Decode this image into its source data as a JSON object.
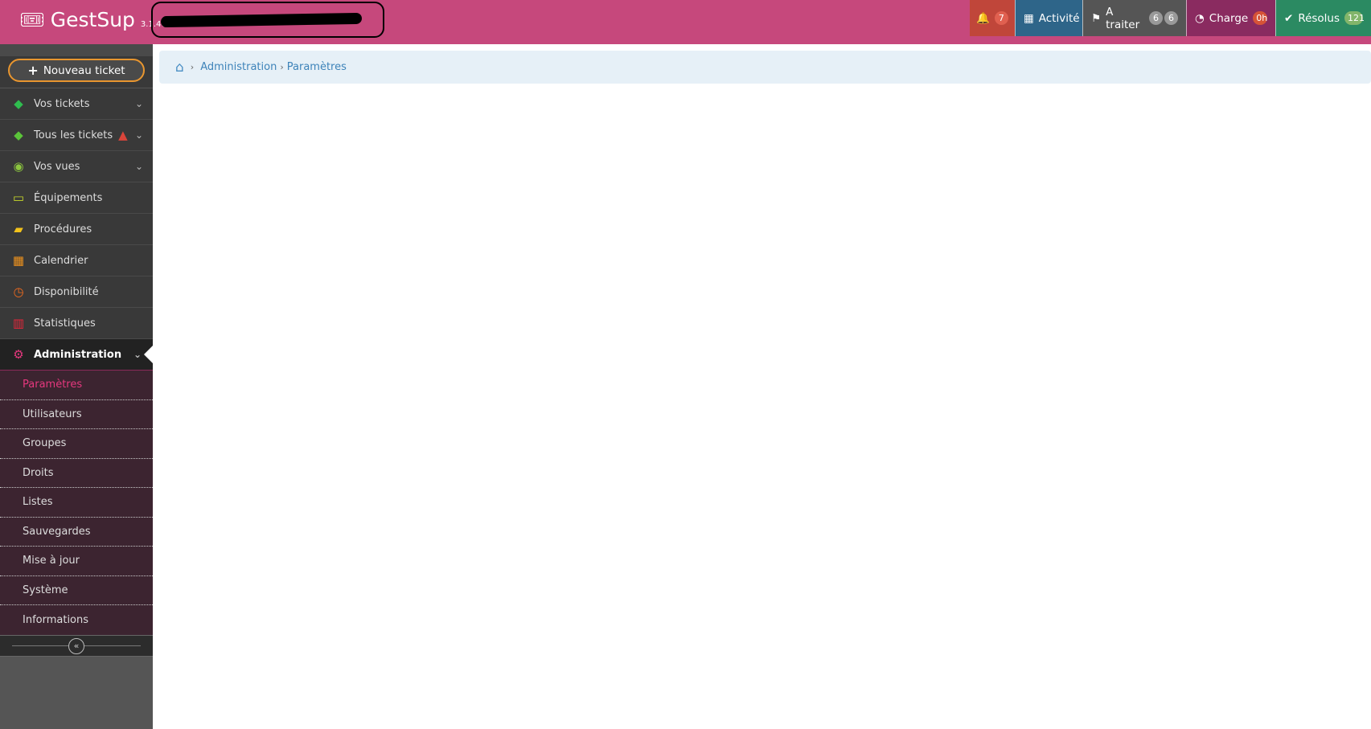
{
  "header": {
    "app_name": "GestSup",
    "version": "3.1.47",
    "nav": [
      {
        "label": "",
        "badge": "7",
        "icon": "bell-icon",
        "bg": "#c0463a",
        "badge_bg": "#e06050"
      },
      {
        "label": "Activité",
        "icon": "calendar-icon",
        "bg": "#2e6589"
      },
      {
        "label": "A traiter",
        "badges": [
          "6",
          "6"
        ],
        "icon": "flag-icon",
        "bg": "#555555",
        "badge_bg": "#999999"
      },
      {
        "label": "Charge",
        "badge": "0h",
        "icon": "dashboard-icon",
        "bg": "#8a2b60",
        "badge_bg": "#d65337"
      },
      {
        "label": "Résolus",
        "badge": "121",
        "icon": "check-circle-icon",
        "bg": "#2b8a62",
        "badge_bg": "#82b56a"
      }
    ]
  },
  "sidebar": {
    "new_ticket": "Nouveau ticket",
    "items": [
      {
        "label": "Vos tickets",
        "icon": "ticket-icon"
      },
      {
        "label": "Tous les tickets",
        "icon": "ticket-icon",
        "alert": "warning-icon"
      },
      {
        "label": "Vos vues",
        "icon": "eye-icon"
      },
      {
        "label": "Équipements",
        "icon": "desktop-icon"
      },
      {
        "label": "Procédures",
        "icon": "book-icon"
      },
      {
        "label": "Calendrier",
        "icon": "calendar-icon"
      },
      {
        "label": "Disponibilité",
        "icon": "clock-icon"
      },
      {
        "label": "Statistiques",
        "icon": "bar-chart-icon"
      },
      {
        "label": "Administration",
        "icon": "cogs-icon"
      }
    ],
    "submenu": [
      "Paramètres",
      "Utilisateurs",
      "Groupes",
      "Droits",
      "Listes",
      "Sauvegardes",
      "Mise à jour",
      "Système",
      "Informations"
    ]
  },
  "breadcrumb": {
    "items": [
      "Administration",
      "Paramètres"
    ]
  }
}
